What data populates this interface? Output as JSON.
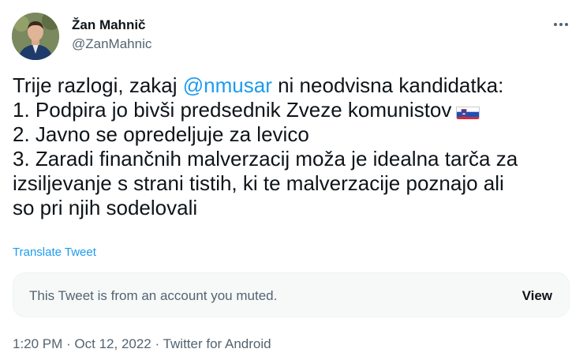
{
  "author": {
    "name": "Žan Mahnič",
    "handle": "@ZanMahnic"
  },
  "tweet": {
    "line1_prefix": "Trije razlogi, zakaj ",
    "mention": "@nmusar",
    "line1_suffix": " ni neodvisna kandidatka:",
    "line2": "1. Podpira jo bivši predsednik Zveze komunistov",
    "line2_flag": "flag-slovenia",
    "line3": "2. Javno se opredeljuje za levico",
    "line4": "3. Zaradi finančnih malverzacij moža je idealna tarča za",
    "line5": "izsiljevanje s strani tistih, ki te malverzacije poznajo ali",
    "line6": "so pri njih sodelovali"
  },
  "translate_label": "Translate Tweet",
  "muted_notice": {
    "text": "This Tweet is from an account you muted.",
    "view_label": "View"
  },
  "meta": {
    "time": "1:20 PM",
    "separator1": " · ",
    "date": "Oct 12, 2022",
    "separator2": " · ",
    "source": "Twitter for Android"
  },
  "colors": {
    "accent": "#1d9bf0",
    "secondary_text": "#536471",
    "primary_text": "#0f1419"
  },
  "icons": [
    "more-options-icon",
    "flag-slovenia-icon",
    "avatar-photo"
  ]
}
